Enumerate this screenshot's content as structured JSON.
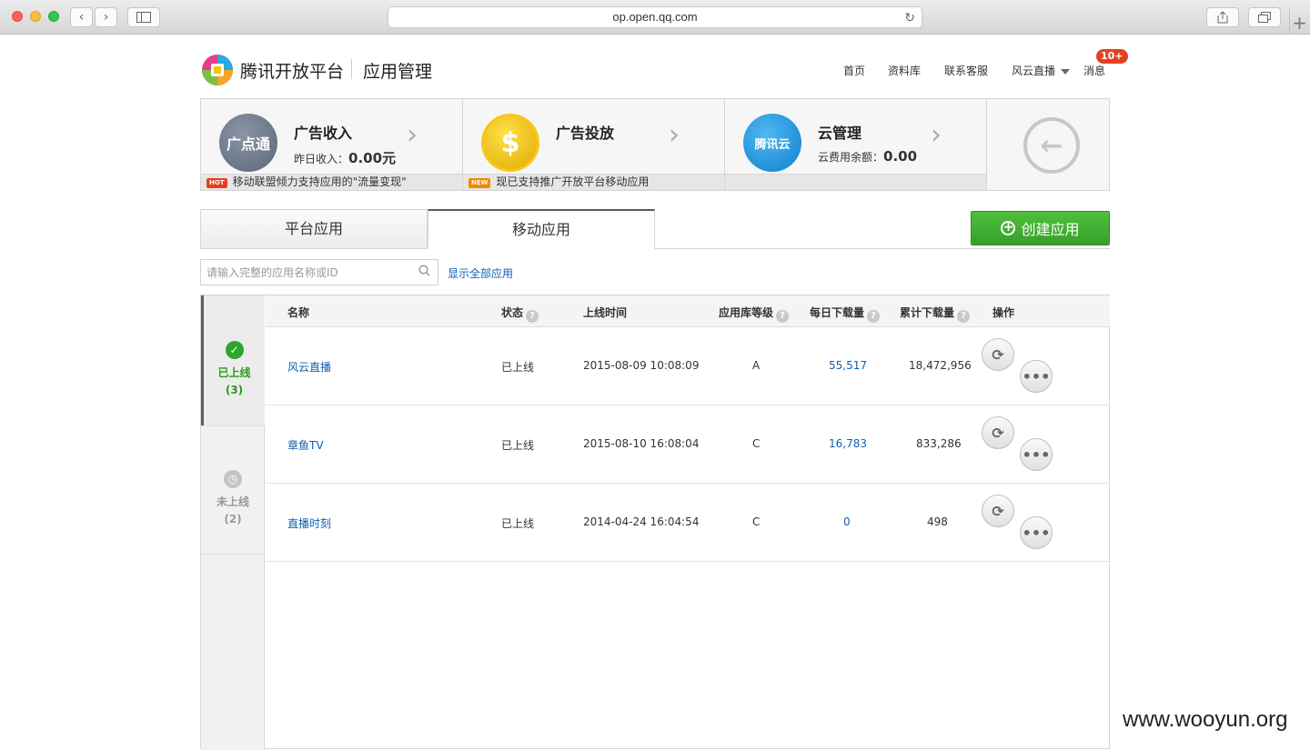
{
  "browser": {
    "url": "op.open.qq.com"
  },
  "header": {
    "brand": "腾讯开放平台",
    "section": "应用管理",
    "nav": {
      "home": "首页",
      "docs": "资料库",
      "support": "联系客服",
      "user": "风云直播",
      "messages": "消息",
      "messages_badge": "10+"
    }
  },
  "promo": {
    "ad_income": {
      "icon_text": "广点通",
      "title": "广告收入",
      "sub_label": "昨日收入：",
      "sub_value": "0.00元",
      "tag": "HOT",
      "foot": "移动联盟倾力支持应用的\"流量变现\""
    },
    "ad_placement": {
      "icon_text": "$",
      "title": "广告投放",
      "tag": "NEW",
      "foot": "现已支持推广开放平台移动应用"
    },
    "cloud": {
      "icon_text": "腾讯云",
      "title": "云管理",
      "sub_label": "云费用余额：",
      "sub_value": "0.00"
    }
  },
  "tabs": {
    "platform": "平台应用",
    "mobile": "移动应用"
  },
  "create_button": "创建应用",
  "search": {
    "placeholder": "请输入完整的应用名称或ID",
    "show_all": "显示全部应用"
  },
  "side": {
    "online": {
      "label": "已上线",
      "count": "(3)"
    },
    "offline": {
      "label": "未上线",
      "count": "(2)"
    }
  },
  "table": {
    "headers": {
      "name": "名称",
      "status": "状态",
      "time": "上线时间",
      "grade": "应用库等级",
      "daily": "每日下载量",
      "total": "累计下载量",
      "ops": "操作"
    },
    "rows": [
      {
        "name": "风云直播",
        "status": "已上线",
        "time": "2015-08-09 10:08:09",
        "grade": "A",
        "daily": "55,517",
        "total": "18,472,956"
      },
      {
        "name": "章鱼TV",
        "status": "已上线",
        "time": "2015-08-10 16:08:04",
        "grade": "C",
        "daily": "16,783",
        "total": "833,286"
      },
      {
        "name": "直播时刻",
        "status": "已上线",
        "time": "2014-04-24 16:04:54",
        "grade": "C",
        "daily": "0",
        "total": "498"
      }
    ]
  },
  "watermark": "www.wooyun.org",
  "colors": {
    "accent_green": "#37a02b",
    "link_blue": "#0f5fb4",
    "hot_red": "#e4401f"
  }
}
